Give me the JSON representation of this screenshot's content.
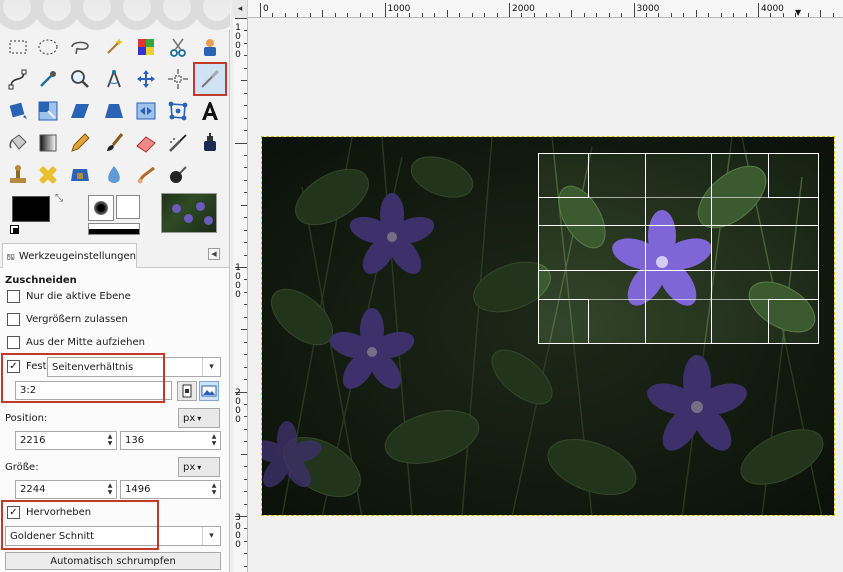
{
  "toolbox": {
    "tools": [
      {
        "id": "rect-select",
        "icon": "rect-select-icon"
      },
      {
        "id": "ellipse-select",
        "icon": "ellipse-select-icon"
      },
      {
        "id": "free-select",
        "icon": "lasso-icon"
      },
      {
        "id": "fuzzy-select",
        "icon": "magic-wand-icon"
      },
      {
        "id": "color-select",
        "icon": "select-by-color-icon"
      },
      {
        "id": "scissors",
        "icon": "scissors-icon"
      },
      {
        "id": "foreground-select",
        "icon": "foreground-select-icon"
      },
      {
        "id": "paths",
        "icon": "paths-icon"
      },
      {
        "id": "color-picker",
        "icon": "eyedropper-icon"
      },
      {
        "id": "zoom",
        "icon": "magnifier-icon"
      },
      {
        "id": "measure",
        "icon": "compass-icon"
      },
      {
        "id": "move",
        "icon": "move-icon"
      },
      {
        "id": "align",
        "icon": "align-icon"
      },
      {
        "id": "crop",
        "icon": "crop-knife-icon"
      },
      {
        "id": "rotate",
        "icon": "rotate-icon"
      },
      {
        "id": "scale",
        "icon": "scale-icon"
      },
      {
        "id": "shear",
        "icon": "shear-icon"
      },
      {
        "id": "perspective",
        "icon": "perspective-icon"
      },
      {
        "id": "flip",
        "icon": "flip-icon"
      },
      {
        "id": "cage",
        "icon": "cage-icon"
      },
      {
        "id": "text",
        "icon": "text-icon"
      },
      {
        "id": "bucket-fill",
        "icon": "bucket-icon"
      },
      {
        "id": "blend",
        "icon": "gradient-icon"
      },
      {
        "id": "pencil",
        "icon": "pencil-icon"
      },
      {
        "id": "paintbrush",
        "icon": "paintbrush-icon"
      },
      {
        "id": "eraser",
        "icon": "eraser-icon"
      },
      {
        "id": "airbrush",
        "icon": "airbrush-icon"
      },
      {
        "id": "ink",
        "icon": "ink-icon"
      },
      {
        "id": "clone",
        "icon": "clone-stamp-icon"
      },
      {
        "id": "heal",
        "icon": "heal-icon"
      },
      {
        "id": "perspective-clone",
        "icon": "perspective-clone-icon"
      },
      {
        "id": "blur",
        "icon": "blur-drop-icon"
      },
      {
        "id": "smudge",
        "icon": "smudge-icon"
      },
      {
        "id": "dodge-burn",
        "icon": "dodge-burn-icon"
      }
    ],
    "active_tool": "crop"
  },
  "options": {
    "tab_label": "Werkzeugeinstellungen",
    "section_title": "Zuschneiden",
    "only_active_layer": {
      "label": "Nur die aktive Ebene",
      "checked": false
    },
    "allow_growing": {
      "label": "Vergrößern zulassen",
      "checked": false
    },
    "expand_from_center": {
      "label": "Aus der Mitte aufziehen",
      "checked": false
    },
    "fixed": {
      "label": "Fest:",
      "checked": true,
      "mode": "Seitenverhältnis",
      "value": "3:2"
    },
    "position": {
      "label": "Position:",
      "x": "2216",
      "y": "136",
      "unit": "px"
    },
    "size": {
      "label": "Größe:",
      "w": "2244",
      "h": "1496",
      "unit": "px"
    },
    "highlight": {
      "label": "Hervorheben",
      "checked": true
    },
    "guides": {
      "value": "Goldener Schnitt"
    },
    "auto_shrink_label": "Automatisch schrumpfen"
  },
  "ruler": {
    "h_labels": [
      "0",
      "1000",
      "2000",
      "3000",
      "4000"
    ],
    "v_labels": [
      "1000",
      "1000",
      "2000",
      "3000"
    ]
  },
  "colors": {
    "highlight_box": "#c0392b",
    "fg": "#000000",
    "bg": "#ffffff"
  }
}
